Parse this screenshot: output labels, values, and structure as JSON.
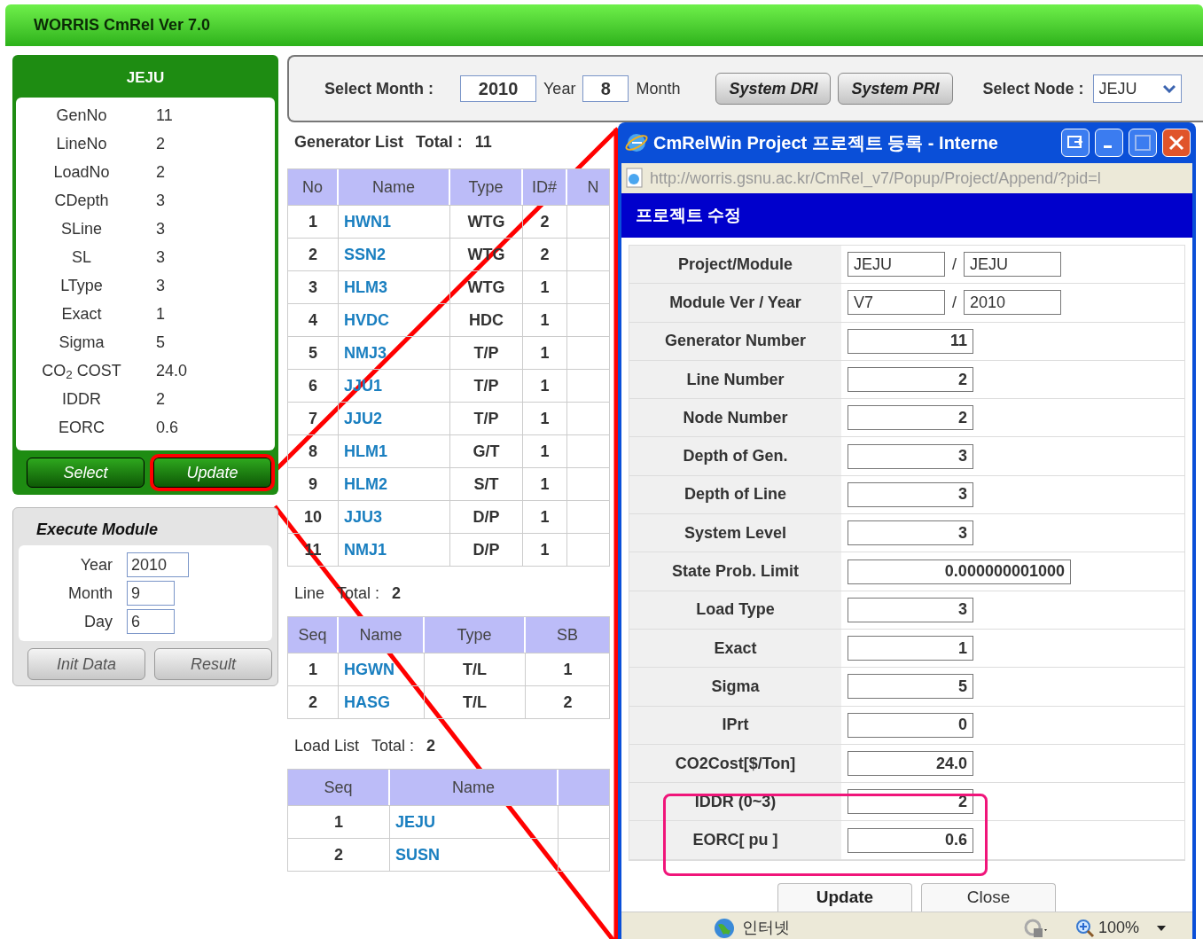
{
  "app_title": "WORRIS CmRel Ver 7.0",
  "project_panel": {
    "title": "JEJU",
    "stats": [
      {
        "label": "GenNo",
        "value": "11"
      },
      {
        "label": "LineNo",
        "value": "2"
      },
      {
        "label": "LoadNo",
        "value": "2"
      },
      {
        "label": "CDepth",
        "value": "3"
      },
      {
        "label": "SLine",
        "value": "3"
      },
      {
        "label": "SL",
        "value": "3"
      },
      {
        "label": "LType",
        "value": "3"
      },
      {
        "label": "Exact",
        "value": "1"
      },
      {
        "label": "Sigma",
        "value": "5"
      },
      {
        "label": "CO$_{2}$ COST",
        "value": "24.0"
      },
      {
        "label": "IDDR",
        "value": "2"
      },
      {
        "label": "EORC",
        "value": "0.6"
      }
    ],
    "buttons": [
      {
        "label": "Select",
        "highlighted": false
      },
      {
        "label": "Update",
        "highlighted": true
      }
    ]
  },
  "execute_module": {
    "title": "Execute Module",
    "fields": [
      {
        "label": "Year",
        "value": "2010"
      },
      {
        "label": "Month",
        "value": "9"
      },
      {
        "label": "Day",
        "value": "6"
      }
    ],
    "buttons": [
      "Init Data",
      "Result"
    ]
  },
  "filter_bar": {
    "label": "Select Month :",
    "year": "2010",
    "year_unit": "Year",
    "month": "8",
    "month_unit": "Month",
    "buttons": [
      "System DRI",
      "System PRI"
    ],
    "node_label": "Select Node :",
    "node": "JEJU"
  },
  "generator_list": {
    "title": "Generator List",
    "total_label": "Total :",
    "total": "11",
    "columns": [
      "No",
      "Name",
      "Type",
      "ID#",
      "N"
    ],
    "rows": [
      [
        "1",
        "HWN1",
        "WTG",
        "2"
      ],
      [
        "2",
        "SSN2",
        "WTG",
        "2"
      ],
      [
        "3",
        "HLM3",
        "WTG",
        "1"
      ],
      [
        "4",
        "HVDC",
        "HDC",
        "1"
      ],
      [
        "5",
        "NMJ3",
        "T/P",
        "1"
      ],
      [
        "6",
        "JJU1",
        "T/P",
        "1"
      ],
      [
        "7",
        "JJU2",
        "T/P",
        "1"
      ],
      [
        "8",
        "HLM1",
        "G/T",
        "1"
      ],
      [
        "9",
        "HLM2",
        "S/T",
        "1"
      ],
      [
        "10",
        "JJU3",
        "D/P",
        "1"
      ],
      [
        "11",
        "NMJ1",
        "D/P",
        "1"
      ]
    ]
  },
  "line_list": {
    "title": "Line",
    "total_label": "Total :",
    "total": "2",
    "columns": [
      "Seq",
      "Name",
      "Type",
      "SB"
    ],
    "rows": [
      [
        "1",
        "HGWN",
        "T/L",
        "1"
      ],
      [
        "2",
        "HASG",
        "T/L",
        "2"
      ]
    ]
  },
  "load_list": {
    "title": "Load List",
    "total_label": "Total :",
    "total": "2",
    "columns": [
      "Seq",
      "Name"
    ],
    "rows": [
      [
        "1",
        "JEJU"
      ],
      [
        "2",
        "SUSN"
      ]
    ]
  },
  "popup": {
    "title": "CmRelWin Project 프로젝트 등록 - Interne",
    "url": "http://worris.gsnu.ac.kr/CmRel_v7/Popup/Project/Append/?pid=l",
    "heading": "프로젝트 수정",
    "rows": [
      {
        "label": "Project/Module",
        "values": [
          "JEJU",
          "JEJU"
        ],
        "separator": "/",
        "highlighted": false
      },
      {
        "label": "Module Ver / Year",
        "values": [
          "V7",
          "2010"
        ],
        "separator": "/",
        "highlighted": false
      },
      {
        "label": "Generator Number",
        "values": [
          "11"
        ],
        "highlighted": false
      },
      {
        "label": "Line Number",
        "values": [
          "2"
        ],
        "highlighted": false
      },
      {
        "label": "Node Number",
        "values": [
          "2"
        ],
        "highlighted": false
      },
      {
        "label": "Depth of Gen.",
        "values": [
          "3"
        ],
        "highlighted": false
      },
      {
        "label": "Depth of Line",
        "values": [
          "3"
        ],
        "highlighted": false
      },
      {
        "label": "System Level",
        "values": [
          "3"
        ],
        "highlighted": false
      },
      {
        "label": "State Prob. Limit",
        "values": [
          "0.000000001000"
        ],
        "highlighted": false
      },
      {
        "label": "Load Type",
        "values": [
          "3"
        ],
        "highlighted": false
      },
      {
        "label": "Exact",
        "values": [
          "1"
        ],
        "highlighted": false
      },
      {
        "label": "Sigma",
        "values": [
          "5"
        ],
        "highlighted": false
      },
      {
        "label": "IPrt",
        "values": [
          "0"
        ],
        "highlighted": false
      },
      {
        "label": "CO2Cost[$/Ton]",
        "values": [
          "24.0"
        ],
        "highlighted": false
      },
      {
        "label": "IDDR (0~3)",
        "values": [
          "2"
        ],
        "highlighted": true
      },
      {
        "label": "EORC[ pu ]",
        "values": [
          "0.6"
        ],
        "highlighted": true
      }
    ],
    "buttons": [
      "Update",
      "Close"
    ],
    "status": {
      "zone": "인터넷",
      "zoom": "100%"
    }
  }
}
